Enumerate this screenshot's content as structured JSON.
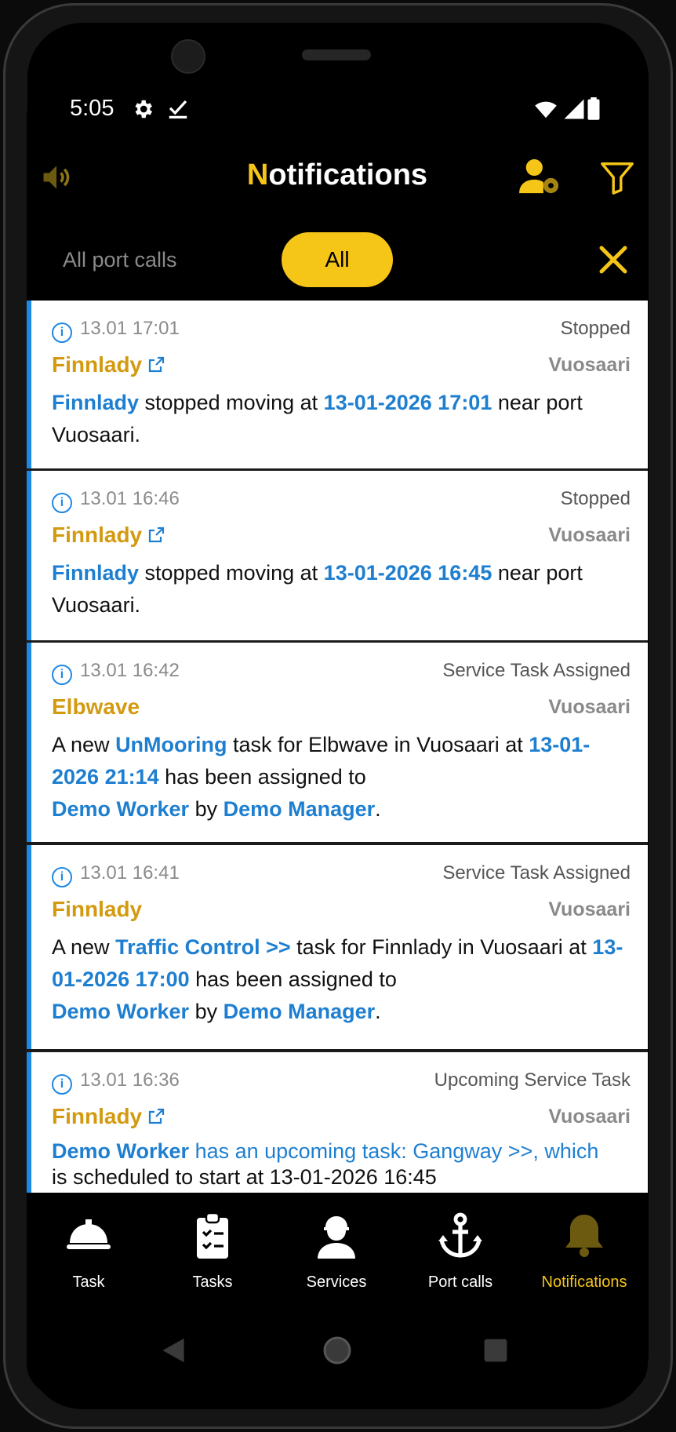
{
  "status": {
    "time": "5:05"
  },
  "header": {
    "title_first": "N",
    "title_rest": "otifications"
  },
  "filters": {
    "all_port_calls": "All port calls",
    "all": "All"
  },
  "colors": {
    "accent": "#f5c518",
    "link": "#1e7fd0",
    "ship": "#d39a10"
  },
  "notifications": [
    {
      "time": "13.01 17:01",
      "type": "Stopped",
      "ship": "Finnlady",
      "port": "Vuosaari",
      "b1": "Finnlady",
      "b2": " stopped moving at ",
      "b3": "13-01-2026 17:01",
      "b4": " near port Vuosaari."
    },
    {
      "time": "13.01 16:46",
      "type": "Stopped",
      "ship": "Finnlady",
      "port": "Vuosaari",
      "b1": "Finnlady",
      "b2": " stopped moving at ",
      "b3": "13-01-2026 16:45",
      "b4": " near port Vuosaari."
    },
    {
      "time": "13.01 16:42",
      "type": "Service Task Assigned",
      "ship": "Elbwave",
      "port": "Vuosaari",
      "b1": "A new ",
      "b2": "UnMooring",
      "b3": " task for Elbwave in Vuosaari at ",
      "b4": "13-01-2026 21:14",
      "b5": " has been assigned to ",
      "b6": "Demo Worker",
      "b7": " by ",
      "b8": "Demo Manager",
      "b9": "."
    },
    {
      "time": "13.01 16:41",
      "type": "Service Task Assigned",
      "ship": "Finnlady",
      "port": "Vuosaari",
      "b1": "A new ",
      "b2": "Traffic Control >>",
      "b3": " task for Finnlady in Vuosaari at ",
      "b4": "13-01-2026 17:00",
      "b5": " has been assigned to ",
      "b6": "Demo Worker",
      "b7": " by ",
      "b8": "Demo Manager",
      "b9": "."
    },
    {
      "time": "13.01 16:36",
      "type": "Upcoming Service Task",
      "ship": "Finnlady",
      "port": "Vuosaari",
      "b1": "Demo Worker",
      "b2": " has an upcoming task: Gangway >>, which",
      "b3": "is scheduled to start at 13-01-2026 16:45"
    }
  ],
  "nav": [
    {
      "label": "Task",
      "icon": "hardhat-icon"
    },
    {
      "label": "Tasks",
      "icon": "clipboard-icon"
    },
    {
      "label": "Services",
      "icon": "worker-icon"
    },
    {
      "label": "Port calls",
      "icon": "anchor-icon"
    },
    {
      "label": "Notifications",
      "icon": "bell-icon"
    }
  ]
}
